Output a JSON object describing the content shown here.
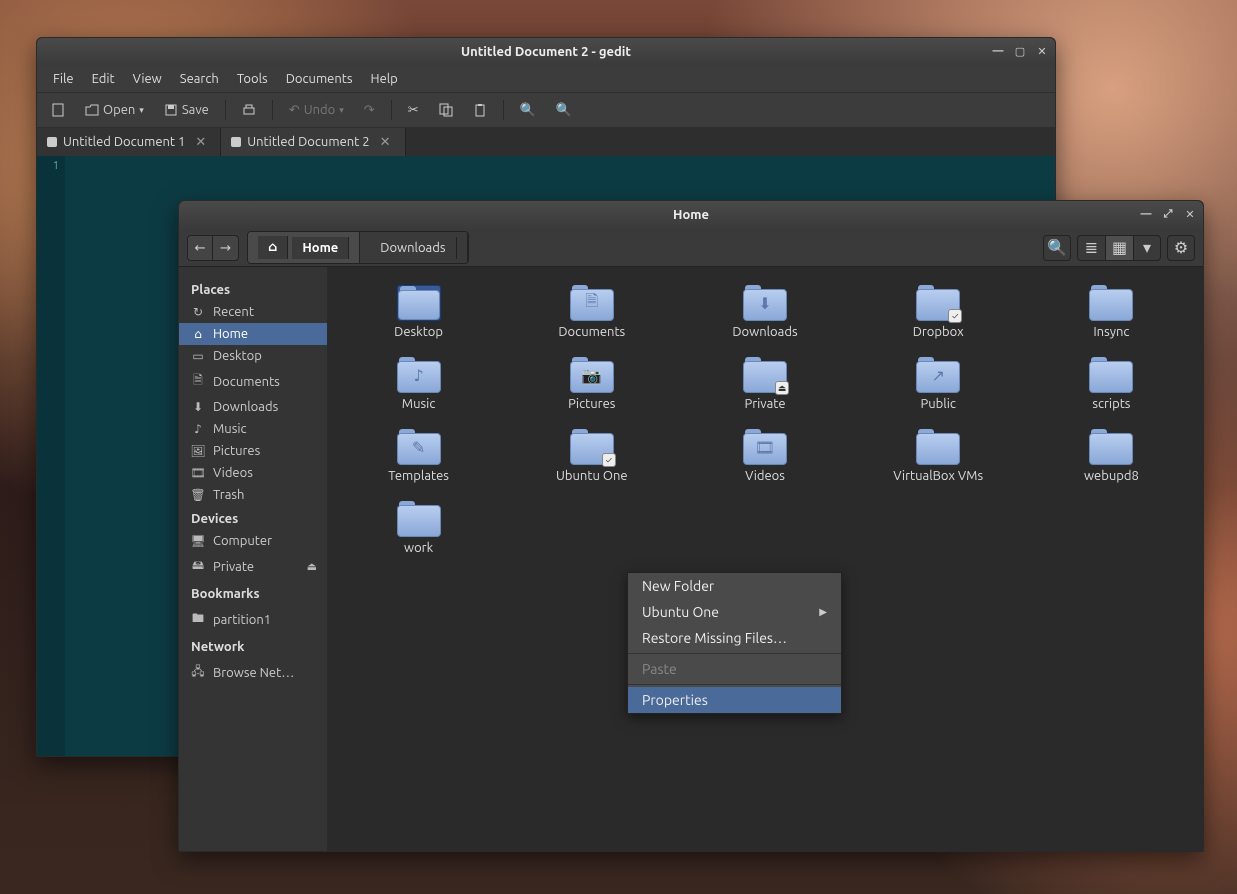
{
  "gedit": {
    "title": "Untitled Document 2 - gedit",
    "menu": [
      "File",
      "Edit",
      "View",
      "Search",
      "Tools",
      "Documents",
      "Help"
    ],
    "toolbar": {
      "open": "Open",
      "save": "Save",
      "undo": "Undo"
    },
    "tabs": [
      {
        "label": "Untitled Document 1"
      },
      {
        "label": "Untitled Document 2"
      }
    ],
    "line": "1"
  },
  "files": {
    "title": "Home",
    "path": [
      "Home",
      "Downloads"
    ],
    "sidebar": {
      "places_head": "Places",
      "places": [
        {
          "label": "Recent",
          "icon": "↻"
        },
        {
          "label": "Home",
          "icon": "⌂",
          "selected": true
        },
        {
          "label": "Desktop",
          "icon": "▭"
        },
        {
          "label": "Documents",
          "icon": "🗎"
        },
        {
          "label": "Downloads",
          "icon": "⬇"
        },
        {
          "label": "Music",
          "icon": "♪"
        },
        {
          "label": "Pictures",
          "icon": "🖼"
        },
        {
          "label": "Videos",
          "icon": "🎞"
        },
        {
          "label": "Trash",
          "icon": "🗑"
        }
      ],
      "devices_head": "Devices",
      "devices": [
        {
          "label": "Computer",
          "icon": "🖥"
        },
        {
          "label": "Private",
          "icon": "🖴",
          "eject": true
        }
      ],
      "bookmarks_head": "Bookmarks",
      "bookmarks": [
        {
          "label": "partition1",
          "icon": "🖿"
        }
      ],
      "network_head": "Network",
      "network": [
        {
          "label": "Browse Net…",
          "icon": "🖧"
        }
      ]
    },
    "grid": [
      {
        "label": "Desktop",
        "overlay": "",
        "variant": "desktop"
      },
      {
        "label": "Documents",
        "overlay": "🗎"
      },
      {
        "label": "Downloads",
        "overlay": "⬇"
      },
      {
        "label": "Dropbox",
        "overlay": "",
        "badge": "✓"
      },
      {
        "label": "Insync",
        "overlay": ""
      },
      {
        "label": "Music",
        "overlay": "♪"
      },
      {
        "label": "Pictures",
        "overlay": "📷"
      },
      {
        "label": "Private",
        "overlay": "",
        "badge": "⏏"
      },
      {
        "label": "Public",
        "overlay": "↗"
      },
      {
        "label": "scripts",
        "overlay": ""
      },
      {
        "label": "Templates",
        "overlay": "✎"
      },
      {
        "label": "Ubuntu One",
        "overlay": "",
        "badge": "✓"
      },
      {
        "label": "Videos",
        "overlay": "🎞"
      },
      {
        "label": "VirtualBox VMs",
        "overlay": ""
      },
      {
        "label": "webupd8",
        "overlay": ""
      },
      {
        "label": "work",
        "overlay": ""
      }
    ],
    "context": {
      "new_folder": "New Folder",
      "ubuntu_one": "Ubuntu One",
      "restore": "Restore Missing Files…",
      "paste": "Paste",
      "properties": "Properties"
    }
  }
}
